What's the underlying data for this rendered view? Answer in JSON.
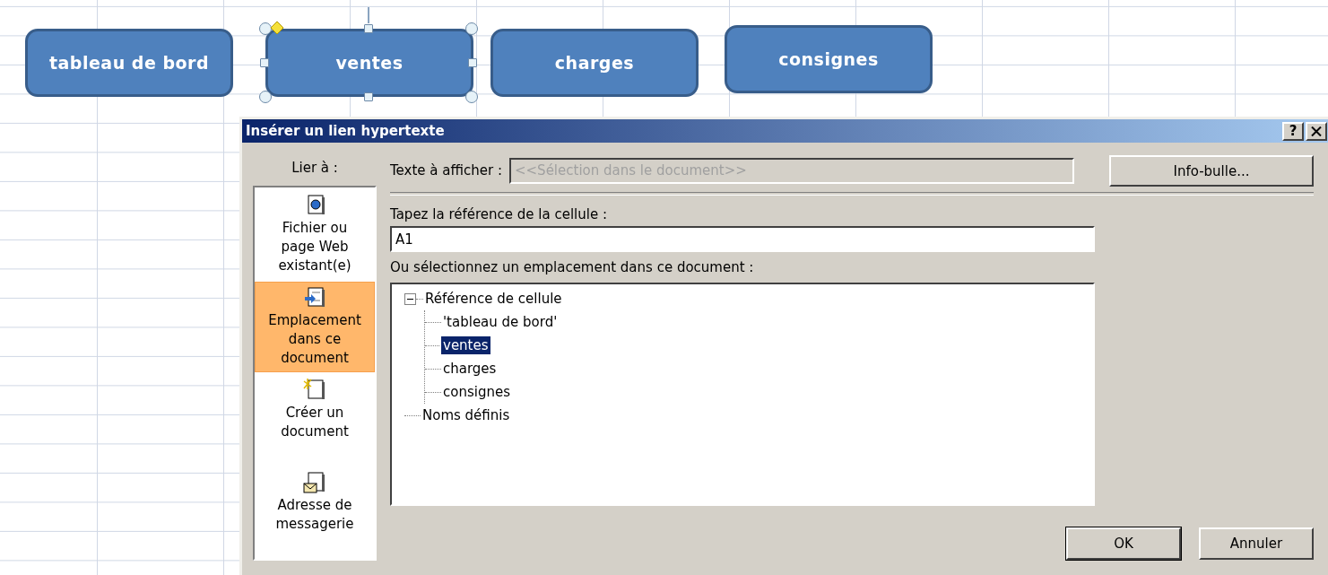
{
  "sheet": {
    "shapes": [
      {
        "label": "tableau de bord",
        "selected": false
      },
      {
        "label": "ventes",
        "selected": true
      },
      {
        "label": "charges",
        "selected": false
      },
      {
        "label": "consignes",
        "selected": false
      }
    ]
  },
  "dialog": {
    "title": "Insérer un lien hypertexte",
    "help_button": "?",
    "link_to": {
      "label": "Lier à :",
      "items": [
        {
          "label": "Fichier ou\npage Web\nexistant(e)",
          "kind": "web-file",
          "selected": false
        },
        {
          "label": "Emplacement\ndans ce\ndocument",
          "kind": "place",
          "selected": true
        },
        {
          "label": "Créer un\ndocument",
          "kind": "new-document",
          "selected": false
        },
        {
          "label": "Adresse de\nmessagerie",
          "kind": "email",
          "selected": false
        }
      ]
    },
    "display_text": {
      "label": "Texte à afficher :",
      "placeholder": "<<Sélection dans le document>>",
      "disabled": true
    },
    "tooltip_button": "Info-bulle...",
    "cell_reference": {
      "label": "Tapez la référence de la cellule :",
      "value": "A1"
    },
    "location": {
      "label": "Ou sélectionnez un emplacement dans ce document :",
      "tree": [
        {
          "label": "Référence de cellule",
          "expanded": true,
          "selected": false,
          "children": [
            {
              "label": "'tableau de bord'",
              "selected": false
            },
            {
              "label": "ventes",
              "selected": true
            },
            {
              "label": "charges",
              "selected": false
            },
            {
              "label": "consignes",
              "selected": false
            }
          ]
        },
        {
          "label": "Noms définis",
          "selected": false
        }
      ]
    },
    "buttons": [
      "OK",
      "Annuler"
    ]
  }
}
